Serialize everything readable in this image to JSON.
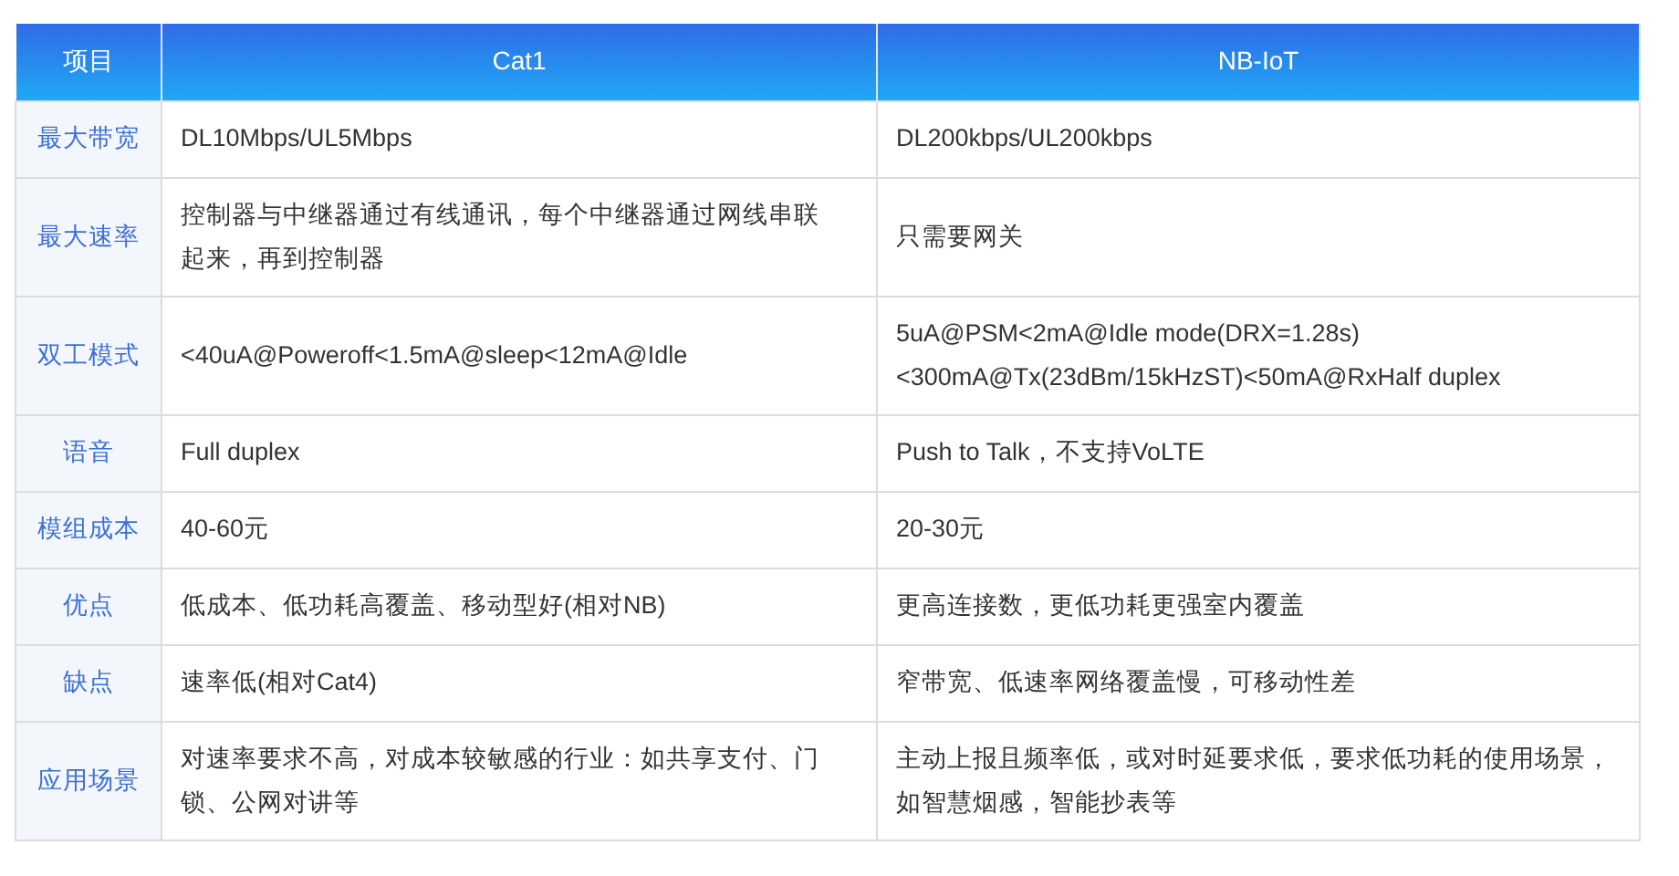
{
  "table": {
    "columns": [
      "项目",
      "Cat1",
      "NB-IoT"
    ],
    "rows": [
      {
        "item": "最大带宽",
        "cat1": "DL10Mbps/UL5Mbps",
        "nbiot": "DL200kbps/UL200kbps"
      },
      {
        "item": "最大速率",
        "cat1": "控制器与中继器通过有线通讯，每个中继器通过网线串联起来，再到控制器",
        "nbiot": "只需要网关"
      },
      {
        "item": "双工模式",
        "cat1": "<40uA@Poweroff<1.5mA@sleep<12mA@Idle",
        "nbiot": "5uA@PSM<2mA@Idle mode(DRX=1.28s)\n<300mA@Tx(23dBm/15kHzST)<50mA@RxHalf duplex"
      },
      {
        "item": "语音",
        "cat1": "Full duplex",
        "nbiot": "Push to Talk，不支持VoLTE"
      },
      {
        "item": "模组成本",
        "cat1": "40-60元",
        "nbiot": "20-30元"
      },
      {
        "item": "优点",
        "cat1": "低成本、低功耗高覆盖、移动型好(相对NB)",
        "nbiot": "更高连接数，更低功耗更强室内覆盖"
      },
      {
        "item": "缺点",
        "cat1": "速率低(相对Cat4)",
        "nbiot": "窄带宽、低速率网络覆盖慢，可移动性差"
      },
      {
        "item": "应用场景",
        "cat1": "对速率要求不高，对成本较敏感的行业：如共享支付、门锁、公网对讲等",
        "nbiot": "主动上报且频率低，或对时延要求低，要求低功耗的使用场景，如智慧烟感，智能抄表等"
      }
    ]
  }
}
